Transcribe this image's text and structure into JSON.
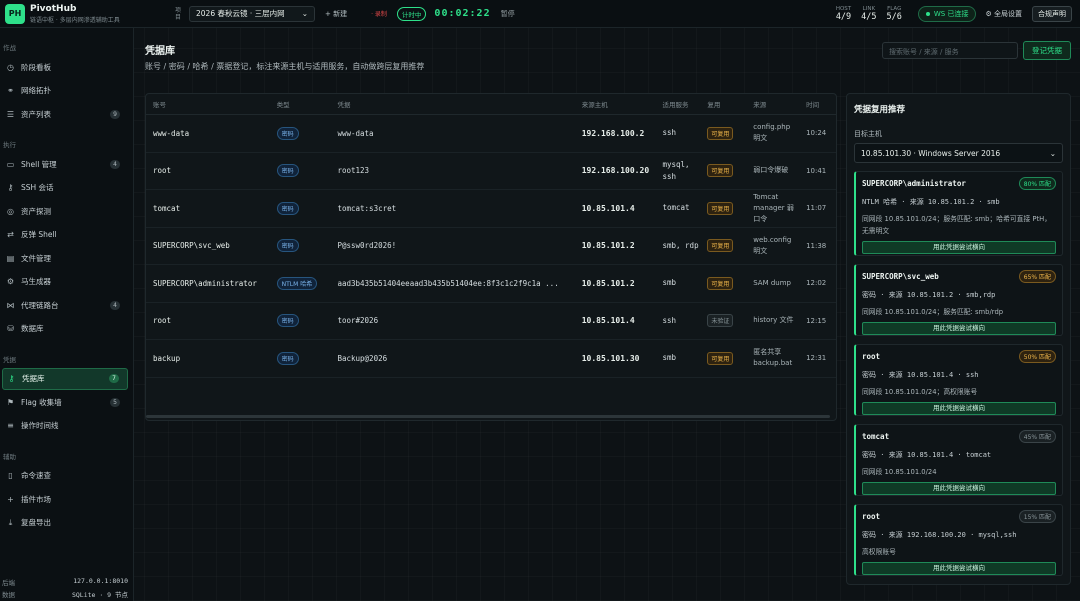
{
  "app": {
    "logo": "PH",
    "name": "PivotHub",
    "subtitle": "链语中枢 · 多层内网渗透辅助工具"
  },
  "topbar": {
    "project_label": "项目",
    "project_value": "2026 春秋云镜 · 三层内网",
    "new_label": "+ 新建",
    "record_label": "· 录制",
    "timer_badge": "计时中",
    "timer": "00:02:22",
    "pause_label": "暂停",
    "stats": [
      {
        "key": "HOST",
        "value": "4/9"
      },
      {
        "key": "LINK",
        "value": "4/5"
      },
      {
        "key": "FLAG",
        "value": "5/6"
      }
    ],
    "ws_status": "WS 已连接",
    "settings_label": "全局设置",
    "legal_label": "合规声明"
  },
  "sidebar": {
    "groups": [
      {
        "label": "作战",
        "items": [
          {
            "label": "阶段看板",
            "icon": "clock-icon"
          },
          {
            "label": "网络拓扑",
            "icon": "network-icon"
          },
          {
            "label": "资产列表",
            "icon": "list-icon",
            "count": "9"
          }
        ]
      },
      {
        "label": "执行",
        "items": [
          {
            "label": "Shell 管理",
            "icon": "terminal-icon",
            "count": "4"
          },
          {
            "label": "SSH 会话",
            "icon": "key-icon"
          },
          {
            "label": "资产探测",
            "icon": "radar-icon"
          },
          {
            "label": "反弹 Shell",
            "icon": "reverse-icon"
          },
          {
            "label": "文件管理",
            "icon": "folder-icon"
          },
          {
            "label": "马生成器",
            "icon": "gear-icon"
          },
          {
            "label": "代理链路台",
            "icon": "proxy-icon",
            "count": "4"
          },
          {
            "label": "数据库",
            "icon": "database-icon"
          }
        ]
      },
      {
        "label": "凭据",
        "items": [
          {
            "label": "凭据库",
            "icon": "key-icon",
            "count": "7",
            "active": true
          },
          {
            "label": "Flag 收集墙",
            "icon": "flag-icon",
            "count": "5"
          },
          {
            "label": "操作时间线",
            "icon": "timeline-icon"
          }
        ]
      },
      {
        "label": "辅助",
        "items": [
          {
            "label": "命令速查",
            "icon": "book-icon"
          },
          {
            "label": "插件市场",
            "icon": "plus-icon"
          },
          {
            "label": "复盘导出",
            "icon": "download-icon"
          }
        ]
      }
    ],
    "footer": [
      {
        "key": "后端",
        "value": "127.0.0.1:8010"
      },
      {
        "key": "数据",
        "value": "SQLite · 9 节点"
      }
    ]
  },
  "page": {
    "title": "凭据库",
    "subtitle": "账号 / 密码 / 哈希 / 票据登记，标注来源主机与适用服务，自动做跨层复用推荐",
    "search_placeholder": "搜索账号 / 来源 / 服务",
    "register_label": "登记凭据"
  },
  "table": {
    "headers": [
      "账号",
      "类型",
      "凭据",
      "来源主机",
      "适用服务",
      "复用",
      "来源",
      "时间"
    ],
    "rows": [
      {
        "account": "www-data",
        "type": "密码",
        "credential": "www-data",
        "host": "192.168.100.2",
        "service": "ssh",
        "reuse": "可复用",
        "reuse_state": "yes",
        "source": "config.php 明文",
        "time": "10:24"
      },
      {
        "account": "root",
        "type": "密码",
        "credential": "root123",
        "host": "192.168.100.20",
        "service": "mysql, ssh",
        "reuse": "可复用",
        "reuse_state": "yes",
        "source": "弱口令爆破",
        "time": "10:41"
      },
      {
        "account": "tomcat",
        "type": "密码",
        "credential": "tomcat:s3cret",
        "host": "10.85.101.4",
        "service": "tomcat",
        "reuse": "可复用",
        "reuse_state": "yes",
        "source": "Tomcat manager 弱口令",
        "time": "11:07"
      },
      {
        "account": "SUPERCORP\\svc_web",
        "type": "密码",
        "credential": "P@ssw0rd2026!",
        "host": "10.85.101.2",
        "service": "smb, rdp",
        "reuse": "可复用",
        "reuse_state": "yes",
        "source": "web.config 明文",
        "time": "11:38"
      },
      {
        "account": "SUPERCORP\\administrator",
        "type": "NTLM 哈希",
        "credential": "aad3b435b51404eeaad3b435b51404ee:8f3c1c2f9c1a ...",
        "host": "10.85.101.2",
        "service": "smb",
        "reuse": "可复用",
        "reuse_state": "yes",
        "source": "SAM dump",
        "time": "12:02"
      },
      {
        "account": "root",
        "type": "密码",
        "credential": "toor#2026",
        "host": "10.85.101.4",
        "service": "ssh",
        "reuse": "未验证",
        "reuse_state": "no",
        "source": "history 文件",
        "time": "12:15"
      },
      {
        "account": "backup",
        "type": "密码",
        "credential": "Backup@2026",
        "host": "10.85.101.30",
        "service": "smb",
        "reuse": "可复用",
        "reuse_state": "yes",
        "source": "匿名共享 backup.bat",
        "time": "12:31"
      }
    ]
  },
  "recommend": {
    "title": "凭据复用推荐",
    "target_label": "目标主机",
    "target_value": "10.85.101.30 · Windows Server 2016",
    "cards": [
      {
        "account": "SUPERCORP\\administrator",
        "match": "80% 匹配",
        "level": "high",
        "meta": "NTLM 哈希 · 来源 10.85.101.2 · smb",
        "desc": "同网段 10.85.101.0/24；服务匹配: smb；哈希可直接 PtH，无需明文",
        "button": "用此凭据尝试横向"
      },
      {
        "account": "SUPERCORP\\svc_web",
        "match": "65% 匹配",
        "level": "mid",
        "meta": "密码 · 来源 10.85.101.2 · smb,rdp",
        "desc": "同网段 10.85.101.0/24；服务匹配: smb/rdp",
        "button": "用此凭据尝试横向"
      },
      {
        "account": "root",
        "match": "50% 匹配",
        "level": "mid",
        "meta": "密码 · 来源 10.85.101.4 · ssh",
        "desc": "同网段 10.85.101.0/24；高权限账号",
        "button": "用此凭据尝试横向"
      },
      {
        "account": "tomcat",
        "match": "45% 匹配",
        "level": "low",
        "meta": "密码 · 来源 10.85.101.4 · tomcat",
        "desc": "同网段 10.85.101.0/24",
        "button": "用此凭据尝试横向"
      },
      {
        "account": "root",
        "match": "15% 匹配",
        "level": "low",
        "meta": "密码 · 来源 192.168.100.20 · mysql,ssh",
        "desc": "高权限账号",
        "button": "用此凭据尝试横向"
      }
    ]
  },
  "colors": {
    "accent": "#2ee08a",
    "warning": "#f1b84c",
    "info": "#7ab3ea",
    "danger": "#e04848"
  }
}
